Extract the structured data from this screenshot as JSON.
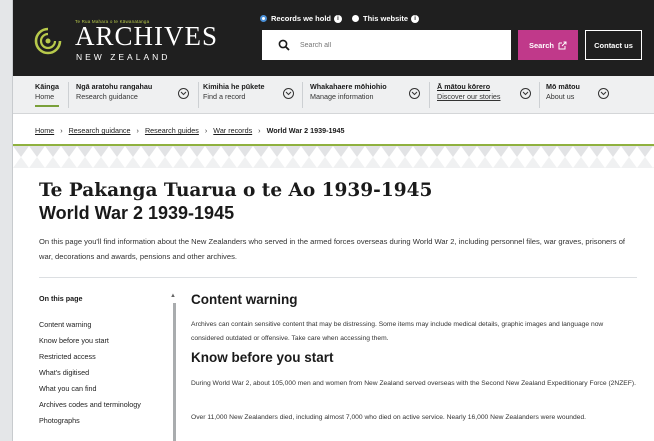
{
  "colors": {
    "header_bg": "#1f1f1f",
    "accent_green": "#8fb13f",
    "search_pink": "#c0398a",
    "radio_blue": "#4a8fd6"
  },
  "logo": {
    "small": "Te Rua Mahara o te Kāwanatanga",
    "archives": "ARCHIVES",
    "nz": "NEW ZEALAND"
  },
  "search": {
    "scope_records": "Records we hold",
    "scope_website": "This website",
    "info_glyph": "i",
    "placeholder": "Search all",
    "button": "Search",
    "contact": "Contact us"
  },
  "nav": {
    "items": [
      {
        "mi": "Kāinga",
        "en": "Home"
      },
      {
        "mi": "Ngā aratohu rangahau",
        "en": "Research guidance"
      },
      {
        "mi": "Kimihia he pūkete",
        "en": "Find a record"
      },
      {
        "mi": "Whakahaere mōhiohio",
        "en": "Manage information"
      },
      {
        "mi": "Ā mātou kōrero",
        "en": "Discover our stories"
      },
      {
        "mi": "Mō mātou",
        "en": "About us"
      }
    ]
  },
  "breadcrumb": {
    "items": [
      "Home",
      "Research guidance",
      "Research guides",
      "War records"
    ],
    "current": "World War 2 1939-1945",
    "separator": "›"
  },
  "page": {
    "title_mi": "Te Pakanga Tuarua o te Ao 1939-1945",
    "title_en": "World War 2 1939-1945",
    "intro": "On this page you'll find information about the New Zealanders who served in the armed forces overseas during World War 2, including personnel files, war graves, prisoners of war, decorations and awards, pensions and other archives."
  },
  "toc": {
    "title": "On this page",
    "items": [
      "Content warning",
      "Know before you start",
      "Restricted access",
      "What's digitised",
      "What you can find",
      "Archives codes and terminology",
      "Photographs"
    ]
  },
  "content": {
    "warning_heading": "Content warning",
    "warning_text": "Archives can contain sensitive content that may be distressing. Some items may include medical details, graphic images and language now considered outdated or offensive. Take care when accessing them.",
    "know_heading": "Know before you start",
    "know_p1": "During World War 2, about 105,000 men and women from New Zealand served overseas with the Second New Zealand Expeditionary Force (2NZEF).",
    "know_p2": "Over 11,000 New Zealanders died, including almost 7,000 who died on active service. Nearly 16,000 New Zealanders were wounded."
  }
}
